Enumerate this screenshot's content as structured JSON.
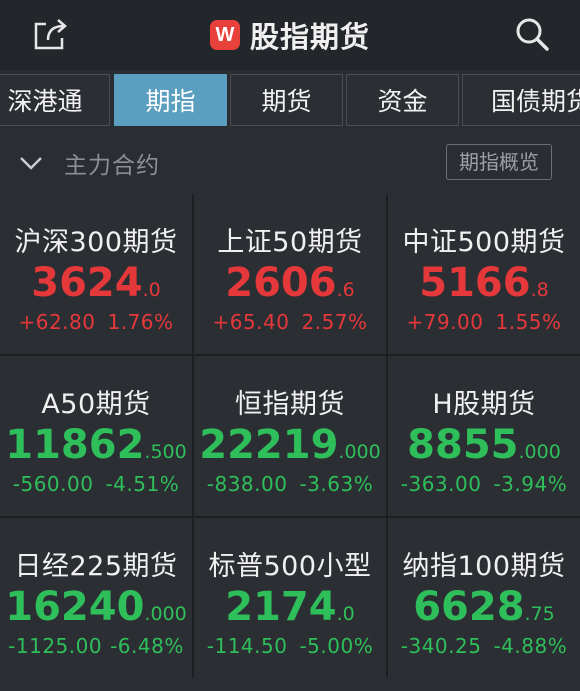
{
  "header": {
    "title": "股指期货",
    "logo_text": "W"
  },
  "tabs": [
    {
      "label": "深港通"
    },
    {
      "label": "期指"
    },
    {
      "label": "期货"
    },
    {
      "label": "资金"
    },
    {
      "label": "国债期货"
    }
  ],
  "subbar": {
    "label": "主力合约",
    "button": "期指概览"
  },
  "cells": [
    {
      "name": "沪深300期货",
      "price_int": "3624",
      "price_dec": ".0",
      "change": "+62.80",
      "pct": "1.76%"
    },
    {
      "name": "上证50期货",
      "price_int": "2606",
      "price_dec": ".6",
      "change": "+65.40",
      "pct": "2.57%"
    },
    {
      "name": "中证500期货",
      "price_int": "5166",
      "price_dec": ".8",
      "change": "+79.00",
      "pct": "1.55%"
    },
    {
      "name": "A50期货",
      "price_int": "11862",
      "price_dec": ".500",
      "change": "-560.00",
      "pct": "-4.51%"
    },
    {
      "name": "恒指期货",
      "price_int": "22219",
      "price_dec": ".000",
      "change": "-838.00",
      "pct": "-3.63%"
    },
    {
      "name": "H股期货",
      "price_int": "8855",
      "price_dec": ".000",
      "change": "-363.00",
      "pct": "-3.94%"
    },
    {
      "name": "日经225期货",
      "price_int": "16240",
      "price_dec": ".000",
      "change": "-1125.00",
      "pct": "-6.48%"
    },
    {
      "name": "标普500小型",
      "price_int": "2174",
      "price_dec": ".0",
      "change": "-114.50",
      "pct": "-5.00%"
    },
    {
      "name": "纳指100期货",
      "price_int": "6628",
      "price_dec": ".75",
      "change": "-340.25",
      "pct": "-4.88%"
    }
  ],
  "colors": {
    "up": "#e5383b",
    "down": "#2fbf5a",
    "active_tab": "#5b9fc0"
  }
}
